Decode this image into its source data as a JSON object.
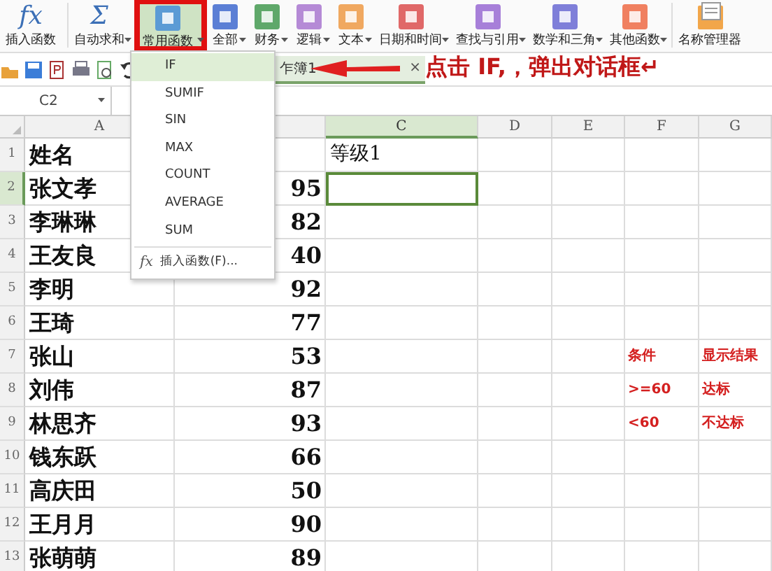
{
  "ribbon": {
    "items": [
      {
        "kind": "glyph",
        "glyph": "fx",
        "label": "插入函数",
        "dropdown": false,
        "selected": false
      },
      {
        "kind": "glyph",
        "glyph": "Σ",
        "label": "自动求和",
        "dropdown": true,
        "selected": false
      },
      {
        "kind": "tile",
        "color": "#5b9bd5",
        "label": "常用函数",
        "dropdown": true,
        "selected": true
      },
      {
        "kind": "tile",
        "color": "#5b7fd5",
        "label": "全部",
        "dropdown": true,
        "selected": false
      },
      {
        "kind": "tile",
        "color": "#5fa86a",
        "label": "财务",
        "dropdown": true,
        "selected": false
      },
      {
        "kind": "tile",
        "color": "#b58ad6",
        "label": "逻辑",
        "dropdown": true,
        "selected": false
      },
      {
        "kind": "tile",
        "color": "#f0a860",
        "label": "文本",
        "dropdown": true,
        "selected": false
      },
      {
        "kind": "tile",
        "color": "#e06868",
        "label": "日期和时间",
        "dropdown": true,
        "selected": false
      },
      {
        "kind": "tile",
        "color": "#a77fd9",
        "label": "查找与引用",
        "dropdown": true,
        "selected": false
      },
      {
        "kind": "tile",
        "color": "#7f7fd9",
        "label": "数学和三角",
        "dropdown": true,
        "selected": false
      },
      {
        "kind": "tile",
        "color": "#f08060",
        "label": "其他函数",
        "dropdown": true,
        "selected": false
      },
      {
        "kind": "book",
        "label": "名称管理器",
        "dropdown": false,
        "selected": false
      }
    ]
  },
  "sheet_tab": {
    "label": "乍簿1",
    "close": "×"
  },
  "name_box": {
    "value": "C2"
  },
  "columns": [
    {
      "label": "A",
      "selected": false
    },
    {
      "selected": false
    },
    {
      "label": "C",
      "selected": true
    },
    {
      "label": "D",
      "selected": false
    },
    {
      "label": "E",
      "selected": false
    },
    {
      "label": "F",
      "selected": false
    },
    {
      "label": "G",
      "selected": false
    }
  ],
  "rows": [
    {
      "number": "1",
      "selected": false,
      "cells": {
        "a": "姓名",
        "c": "等级1"
      }
    },
    {
      "number": "2",
      "selected": true,
      "cells": {
        "a": "张文孝",
        "b": "95"
      }
    },
    {
      "number": "3",
      "selected": false,
      "cells": {
        "a": "李琳琳",
        "b": "82"
      }
    },
    {
      "number": "4",
      "selected": false,
      "cells": {
        "a": "王友良",
        "b": "40"
      }
    },
    {
      "number": "5",
      "selected": false,
      "cells": {
        "a": "李明",
        "b": "92"
      }
    },
    {
      "number": "6",
      "selected": false,
      "cells": {
        "a": "王琦",
        "b": "77"
      }
    },
    {
      "number": "7",
      "selected": false,
      "cells": {
        "a": "张山",
        "b": "53",
        "f": "条件",
        "g": "显示结果"
      }
    },
    {
      "number": "8",
      "selected": false,
      "cells": {
        "a": "刘伟",
        "b": "87",
        "f": ">=60",
        "g": "达标"
      }
    },
    {
      "number": "9",
      "selected": false,
      "cells": {
        "a": "林思齐",
        "b": "93",
        "f": "<60",
        "g": "不达标"
      }
    },
    {
      "number": "10",
      "selected": false,
      "cells": {
        "a": "钱东跃",
        "b": "66"
      }
    },
    {
      "number": "11",
      "selected": false,
      "cells": {
        "a": "高庆田",
        "b": "50"
      }
    },
    {
      "number": "12",
      "selected": false,
      "cells": {
        "a": "王月月",
        "b": "90"
      }
    },
    {
      "number": "13",
      "selected": false,
      "cells": {
        "a": "张萌萌",
        "b": "89"
      }
    }
  ],
  "menu": {
    "items": [
      {
        "label": "IF",
        "selected": true
      },
      {
        "label": "SUMIF",
        "selected": false
      },
      {
        "label": "SIN",
        "selected": false
      },
      {
        "label": "MAX",
        "selected": false
      },
      {
        "label": "COUNT",
        "selected": false
      },
      {
        "label": "AVERAGE",
        "selected": false
      },
      {
        "label": "SUM",
        "selected": false
      }
    ],
    "footer": {
      "glyph": "fx",
      "label": "插入函数(F)..."
    }
  },
  "annotation": {
    "text": "点击 IF,，弹出对话框↵"
  }
}
